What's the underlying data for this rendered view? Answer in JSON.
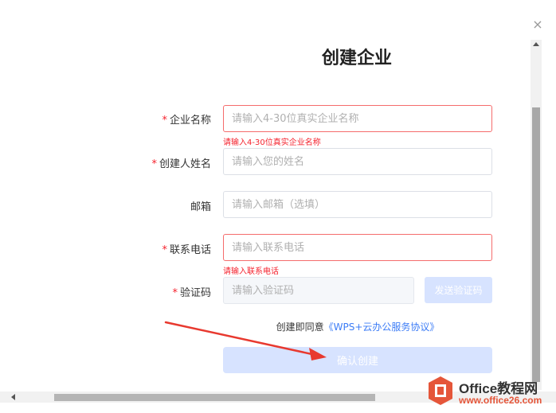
{
  "dialog": {
    "close_glyph": "×",
    "title": "创建企业"
  },
  "form": {
    "required_mark": "*",
    "company": {
      "label": "企业名称",
      "placeholder": "请输入4-30位真实企业名称",
      "value": "",
      "error": "请输入4-30位真实企业名称"
    },
    "creator": {
      "label": "创建人姓名",
      "placeholder": "请输入您的姓名",
      "value": ""
    },
    "email": {
      "label": "邮箱",
      "placeholder": "请输入邮箱（选填）",
      "value": ""
    },
    "phone": {
      "label": "联系电话",
      "placeholder": "请输入联系电话",
      "value": "",
      "error": "请输入联系电话"
    },
    "code": {
      "label": "验证码",
      "placeholder": "请输入验证码",
      "value": "",
      "send_label": "发送验证码"
    },
    "agreement": {
      "prefix": "创建即同意",
      "link": "《WPS+云办公服务协议》"
    },
    "confirm_label": "确认创建"
  },
  "watermark": {
    "brand": "Office教程网",
    "url": "www.office26.com"
  },
  "colors": {
    "accent": "#3c7cf6",
    "error": "#f5222d",
    "button_disabled": "#d7e3ff",
    "annotation": "#e8392f"
  }
}
